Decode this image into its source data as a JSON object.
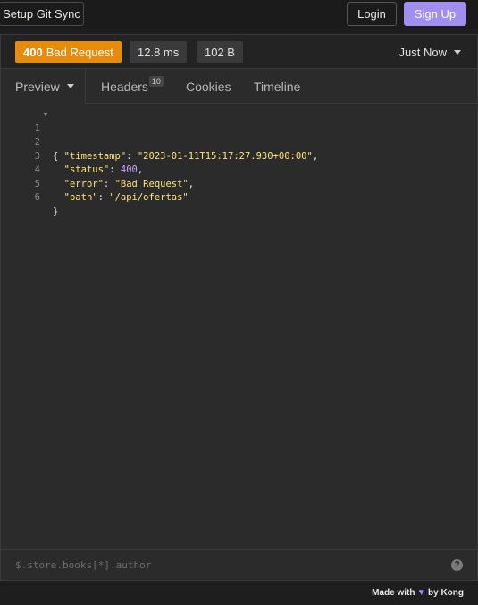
{
  "topbar": {
    "git_sync_label": "Setup Git Sync",
    "login_label": "Login",
    "signup_label": "Sign Up"
  },
  "status": {
    "code": "400",
    "text": "Bad Request",
    "time": "12.8 ms",
    "size": "102 B",
    "when": "Just Now"
  },
  "tabs": {
    "preview": "Preview",
    "headers": "Headers",
    "headers_count": "10",
    "cookies": "Cookies",
    "timeline": "Timeline"
  },
  "code": {
    "line_numbers": [
      "1",
      "2",
      "3",
      "4",
      "5",
      "6"
    ],
    "open_brace": "{",
    "close_brace": "}",
    "timestamp_key": "\"timestamp\"",
    "timestamp_val": "\"2023-01-11T15:17:27.930+00:00\"",
    "status_key": "\"status\"",
    "status_val": "400",
    "error_key": "\"error\"",
    "error_val": "\"Bad Request\"",
    "path_key": "\"path\"",
    "path_val": "\"/api/ofertas\""
  },
  "filter": {
    "placeholder": "$.store.books[*].author",
    "help": "?"
  },
  "footer": {
    "made_with": "Made with",
    "by": "by Kong"
  },
  "colors": {
    "accent": "#a08ff0",
    "status_badge": "#e88a0a",
    "json_string": "#ffe27a",
    "json_number": "#c6a3ff"
  }
}
